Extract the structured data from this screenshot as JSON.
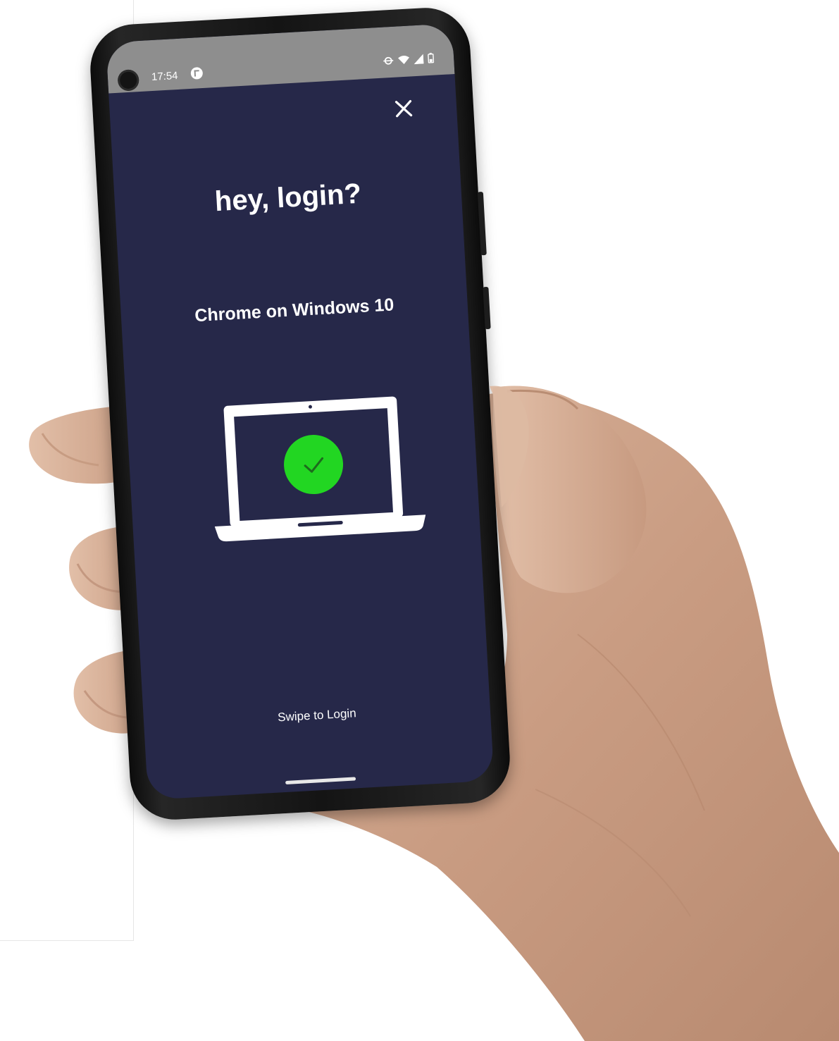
{
  "status_bar": {
    "time": "17:54"
  },
  "screen": {
    "title": "hey, login?",
    "device": "Chrome on Windows 10",
    "swipe_label": "Swipe to Login",
    "status_indicator": "check-icon",
    "close_icon": "close-icon"
  },
  "colors": {
    "screen_background": "#262849",
    "status_bar": "#8e8e8e",
    "success": "#22d622",
    "laptop": "#ffffff"
  }
}
